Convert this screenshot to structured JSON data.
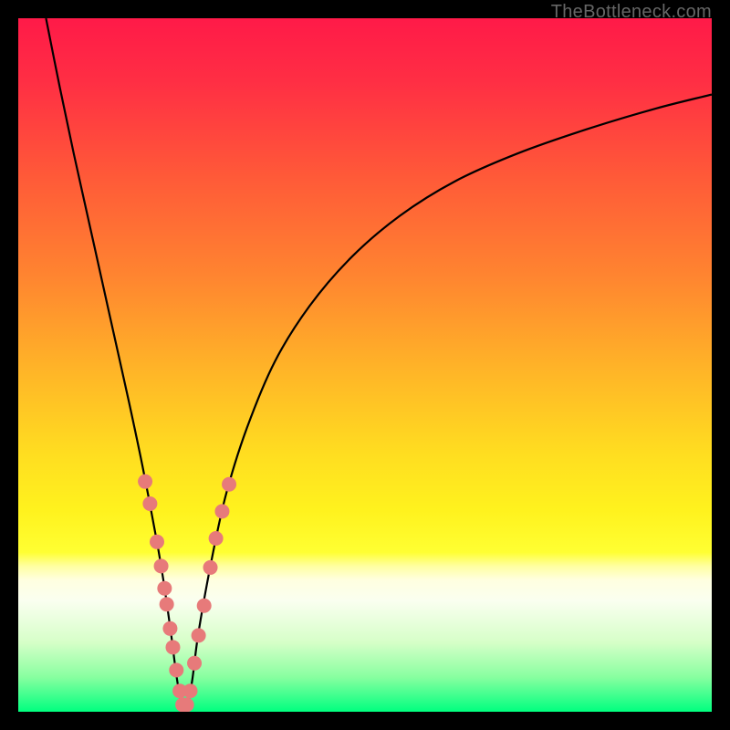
{
  "watermark": "TheBottleneck.com",
  "chart_data": {
    "type": "line",
    "title": "",
    "xlabel": "",
    "ylabel": "",
    "xlim": [
      0,
      100
    ],
    "ylim": [
      0,
      100
    ],
    "background_gradient": {
      "stops": [
        {
          "pos": 0.0,
          "color": "#ff1a48"
        },
        {
          "pos": 0.09,
          "color": "#ff2e44"
        },
        {
          "pos": 0.23,
          "color": "#ff5a38"
        },
        {
          "pos": 0.37,
          "color": "#ff8430"
        },
        {
          "pos": 0.5,
          "color": "#ffb228"
        },
        {
          "pos": 0.63,
          "color": "#ffde20"
        },
        {
          "pos": 0.71,
          "color": "#fff21e"
        },
        {
          "pos": 0.77,
          "color": "#ffff32"
        },
        {
          "pos": 0.79,
          "color": "#ffffa0"
        },
        {
          "pos": 0.81,
          "color": "#ffffe0"
        },
        {
          "pos": 0.84,
          "color": "#fafff0"
        },
        {
          "pos": 0.9,
          "color": "#d6ffc8"
        },
        {
          "pos": 0.95,
          "color": "#88ffa0"
        },
        {
          "pos": 1.0,
          "color": "#00ff7f"
        }
      ]
    },
    "series": [
      {
        "name": "bottleneck-curve",
        "color": "#000000",
        "width": 2.2,
        "x": [
          4.0,
          6.0,
          8.0,
          10.0,
          12.0,
          14.0,
          16.0,
          18.0,
          20.0,
          21.0,
          22.0,
          23.0,
          24.0,
          25.0,
          26.0,
          28.0,
          30.0,
          33.0,
          37.0,
          42.0,
          48.0,
          55.0,
          63.0,
          72.0,
          82.0,
          92.0,
          100.0
        ],
        "y": [
          100.0,
          90.0,
          80.5,
          71.5,
          62.5,
          53.5,
          44.5,
          35.0,
          24.5,
          18.5,
          11.5,
          4.0,
          0.0,
          4.0,
          11.5,
          22.5,
          31.5,
          41.0,
          50.5,
          58.5,
          65.5,
          71.5,
          76.5,
          80.5,
          84.0,
          87.0,
          89.0
        ]
      }
    ],
    "markers": {
      "name": "highlight-dots",
      "color": "#e77a7a",
      "radius": 8,
      "points": [
        {
          "x": 18.3,
          "y": 33.2
        },
        {
          "x": 19.0,
          "y": 30.0
        },
        {
          "x": 20.0,
          "y": 24.5
        },
        {
          "x": 20.6,
          "y": 21.0
        },
        {
          "x": 21.1,
          "y": 17.8
        },
        {
          "x": 21.4,
          "y": 15.5
        },
        {
          "x": 21.9,
          "y": 12.0
        },
        {
          "x": 22.3,
          "y": 9.3
        },
        {
          "x": 22.8,
          "y": 6.0
        },
        {
          "x": 23.3,
          "y": 3.0
        },
        {
          "x": 23.7,
          "y": 1.0
        },
        {
          "x": 24.3,
          "y": 1.0
        },
        {
          "x": 24.8,
          "y": 3.0
        },
        {
          "x": 25.4,
          "y": 7.0
        },
        {
          "x": 26.0,
          "y": 11.0
        },
        {
          "x": 26.8,
          "y": 15.3
        },
        {
          "x": 27.7,
          "y": 20.8
        },
        {
          "x": 28.5,
          "y": 25.0
        },
        {
          "x": 29.4,
          "y": 28.9
        },
        {
          "x": 30.4,
          "y": 32.8
        }
      ]
    }
  }
}
